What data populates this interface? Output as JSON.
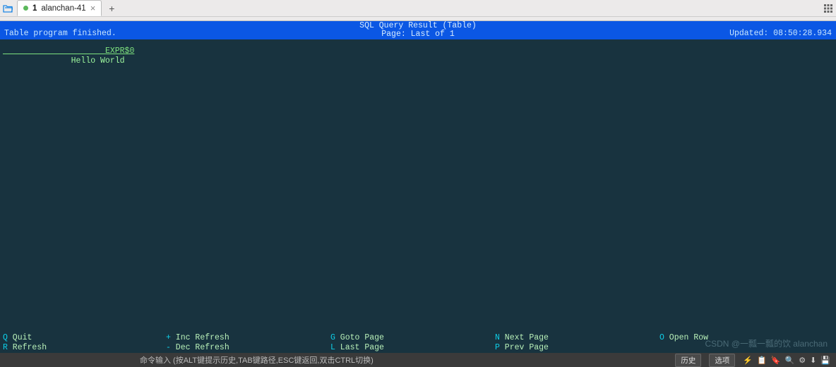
{
  "tabbar": {
    "tab": {
      "seq": "1",
      "title": "alanchan-41"
    },
    "newtab_symbol": "+"
  },
  "console": {
    "bluebar": {
      "left": "Table program finished.",
      "title": "SQL Query Result (Table)",
      "page": "Page: Last of 1",
      "right": "Updated: 08:50:28.934"
    },
    "header_label": "EXPR$0",
    "header_pad": "                     ",
    "rows": [
      {
        "pad": "              ",
        "value": "Hello World"
      }
    ],
    "shortcuts": {
      "q": {
        "key": "Q",
        "label": " Quit"
      },
      "r": {
        "key": "R",
        "label": " Refresh"
      },
      "plus": {
        "key": "+",
        "label": " Inc Refresh"
      },
      "minus": {
        "key": "-",
        "label": " Dec Refresh"
      },
      "g": {
        "key": "G",
        "label": " Goto Page"
      },
      "l": {
        "key": "L",
        "label": " Last Page"
      },
      "n": {
        "key": "N",
        "label": " Next Page"
      },
      "p": {
        "key": "P",
        "label": " Prev Page"
      },
      "o": {
        "key": "O",
        "label": " Open Row"
      }
    }
  },
  "statusbar": {
    "prompt": "命令输入 (按ALT键提示历史,TAB键路径,ESC键返回,双击CTRL切换)",
    "btn_history": "历史",
    "btn_options": "选项"
  },
  "watermark": "CSDN @一瓢一瓢的饮 alanchan"
}
